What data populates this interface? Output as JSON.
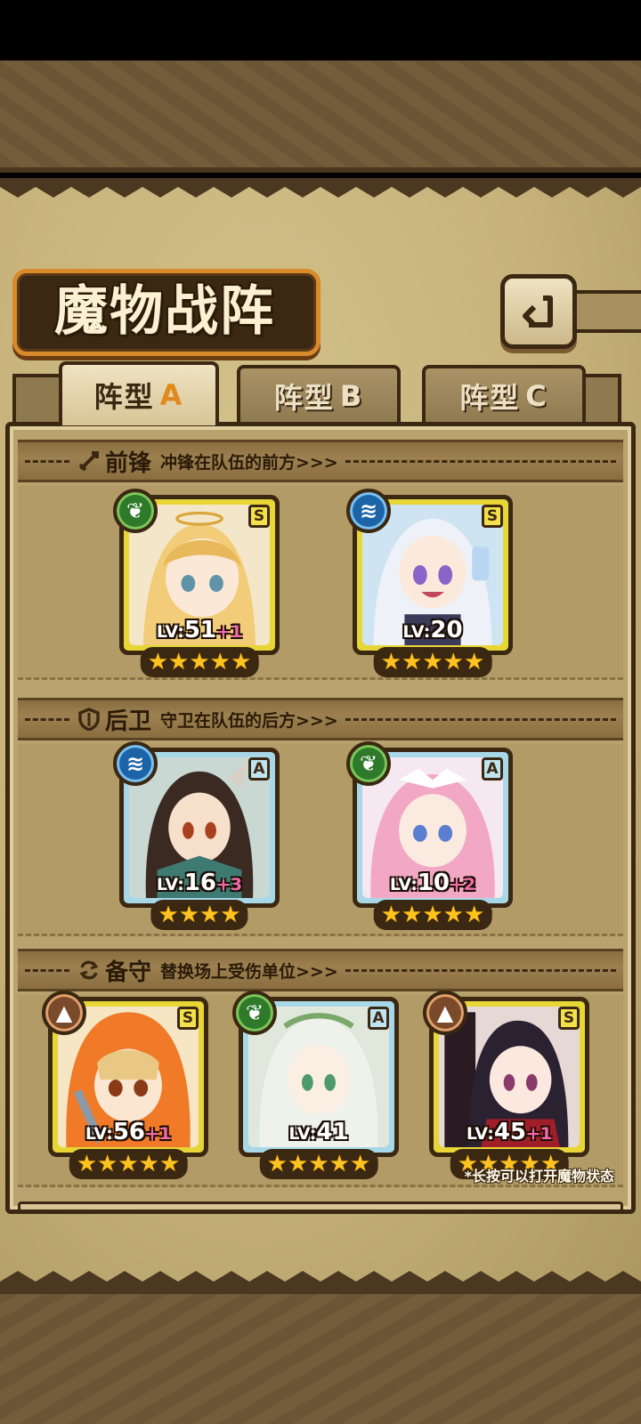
{
  "title": "魔物战阵",
  "back_icon": "return-arrow-icon",
  "tabs": [
    {
      "label": "阵型",
      "letter": "A",
      "active": true
    },
    {
      "label": "阵型",
      "letter": "B",
      "active": false
    },
    {
      "label": "阵型",
      "letter": "C",
      "active": false
    }
  ],
  "sections": {
    "front": {
      "icon": "sword-icon",
      "title": "前锋",
      "desc": "冲锋在队伍的前方>>>"
    },
    "rear": {
      "icon": "shield-icon",
      "title": "后卫",
      "desc": "守卫在队伍的后方>>>"
    },
    "reserve": {
      "icon": "swap-icon",
      "title": "备守",
      "desc": "替换场上受伤单位>>>"
    }
  },
  "cards": [
    {
      "rank": "S",
      "element": "nature-leaf-icon",
      "lv_label": "LV:",
      "level": "51",
      "bonus": "+1",
      "stars": "★★★★★"
    },
    {
      "rank": "S",
      "element": "water-wave-icon",
      "lv_label": "LV:",
      "level": "20",
      "bonus": "",
      "stars": "★★★★★"
    },
    {
      "rank": "A",
      "element": "water-wave-icon",
      "lv_label": "LV:",
      "level": "16",
      "bonus": "+3",
      "stars": "★★★★"
    },
    {
      "rank": "A",
      "element": "nature-leaf-icon",
      "lv_label": "LV:",
      "level": "10",
      "bonus": "+2",
      "stars": "★★★★★"
    },
    {
      "rank": "S",
      "element": "earth-mountain-icon",
      "lv_label": "LV:",
      "level": "56",
      "bonus": "+1",
      "stars": "★★★★★"
    },
    {
      "rank": "A",
      "element": "nature-leaf-icon",
      "lv_label": "LV:",
      "level": "41",
      "bonus": "",
      "stars": "★★★★★"
    },
    {
      "rank": "S",
      "element": "earth-mountain-icon",
      "lv_label": "LV:",
      "level": "45",
      "bonus": "+1",
      "stars": "★★★★★"
    }
  ],
  "hint": "*长按可以打开魔物状态",
  "colors": {
    "rank_s": "#e8d536",
    "rank_a": "#a8d8e8",
    "element_nature": "#2e7a2a",
    "element_water": "#1c63a8",
    "element_earth": "#7a4a2a",
    "star": "#ffc21e",
    "bonus": "#f26aa8",
    "active_tab_letter": "#e08a1e"
  }
}
